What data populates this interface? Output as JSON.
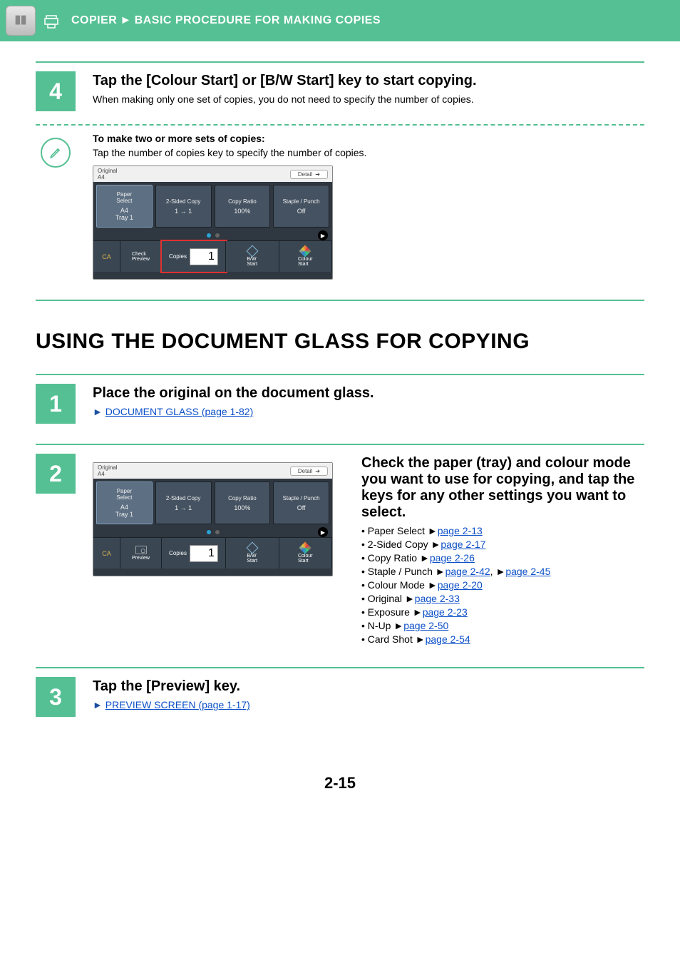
{
  "header": {
    "section": "COPIER",
    "subsection": "BASIC PROCEDURE FOR MAKING COPIES"
  },
  "step4": {
    "num": "4",
    "title": "Tap the [Colour Start] or [B/W Start] key to start copying.",
    "desc": "When making only one set of copies, you do not need to specify the number of copies."
  },
  "note4": {
    "title": "To make two or more sets of copies:",
    "body": "Tap the number of copies key to specify the number of copies."
  },
  "panel": {
    "original_label": "Original",
    "original_size": "A4",
    "detail": "Detail",
    "cards": {
      "c0": {
        "label": "Paper\nSelect",
        "value": "A4\nTray 1"
      },
      "c1": {
        "label": "2-Sided Copy",
        "value": "1 → 1"
      },
      "c2": {
        "label": "Copy Ratio",
        "value": "100%"
      },
      "c3": {
        "label": "Staple / Punch",
        "value": "Off"
      }
    },
    "ca": "CA",
    "preview_a": "Check\nPreview",
    "preview_b": "Preview",
    "copies_label": "Copies",
    "copies_value": "1",
    "bw": "B/W\nStart",
    "colour": "Colour\nStart"
  },
  "section_title": "USING THE DOCUMENT GLASS FOR COPYING",
  "step1": {
    "num": "1",
    "title": "Place the original on the document glass.",
    "link": "DOCUMENT GLASS (page 1-82)"
  },
  "step2": {
    "num": "2",
    "title": "Check the paper (tray) and colour mode you want to use for copying, and tap the keys for any other settings you want to select.",
    "refs": {
      "r0": {
        "name": "Paper Select",
        "page": "page 2-13"
      },
      "r1": {
        "name": "2-Sided Copy",
        "page": "page 2-17"
      },
      "r2": {
        "name": "Copy Ratio",
        "page": "page 2-26"
      },
      "r3": {
        "name": "Staple / Punch",
        "page_a": "page 2-42",
        "page_b": "page 2-45"
      },
      "r4": {
        "name": "Colour Mode",
        "page": "page 2-20"
      },
      "r5": {
        "name": "Original",
        "page": "page 2-33"
      },
      "r6": {
        "name": "Exposure",
        "page": "page 2-23"
      },
      "r7": {
        "name": "N-Up",
        "page": "page 2-50"
      },
      "r8": {
        "name": "Card Shot",
        "page": "page 2-54"
      }
    }
  },
  "step3": {
    "num": "3",
    "title": "Tap the [Preview] key.",
    "link": "PREVIEW SCREEN (page 1-17)"
  },
  "page_number": "2-15"
}
